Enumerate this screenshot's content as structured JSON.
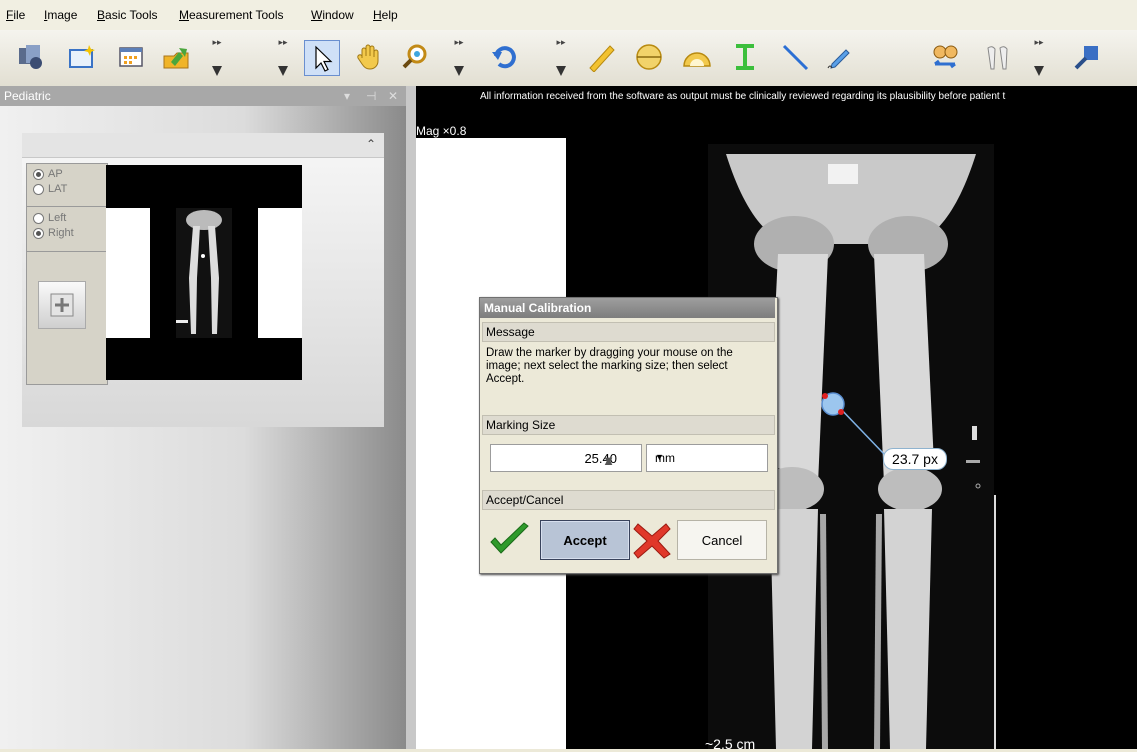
{
  "menu": {
    "items": [
      {
        "accel": "F",
        "rest": "ile"
      },
      {
        "accel": "I",
        "rest": "mage"
      },
      {
        "accel": "B",
        "rest": "asic Tools"
      },
      {
        "accel": "M",
        "rest": "easurement Tools"
      },
      {
        "accel": "W",
        "rest": "indow"
      },
      {
        "accel": "H",
        "rest": "elp"
      }
    ]
  },
  "toolbar": {
    "icons": [
      "open-study-icon",
      "new-image-icon",
      "calendar-icon",
      "export-icon",
      "select-arrow-icon",
      "hand-pan-icon",
      "zoom-icon",
      "undo-icon",
      "ruler-icon",
      "circle-icon",
      "protractor-icon",
      "caliper-icon",
      "line-icon",
      "pen-edit-icon",
      "compare-people-icon",
      "implant-icon",
      "export-dicom-icon"
    ],
    "selected": "select-arrow-icon"
  },
  "left_panel": {
    "title": "Pediatric",
    "title_controls": [
      "▾",
      "⊣",
      "✕"
    ],
    "collapse_glyph": "⌃",
    "view_options": [
      {
        "label": "AP",
        "checked": true
      },
      {
        "label": "LAT",
        "checked": false
      }
    ],
    "side_options": [
      {
        "label": "Left",
        "checked": false
      },
      {
        "label": "Right",
        "checked": true
      }
    ]
  },
  "viewer": {
    "disclaimer": "All information received from the software as output must be clinically reviewed regarding its plausibility before patient t",
    "magnification": "Mag ×0.8",
    "bottom_label": "~2.5 cm",
    "measurement_label": "23.7 px"
  },
  "dialog": {
    "title": "Manual Calibration",
    "message_header": "Message",
    "message": "Draw the marker by dragging your mouse on the image; next select the marking size; then select Accept.",
    "size_header": "Marking Size",
    "size_value": "25.40",
    "unit": "mm",
    "actions_header": "Accept/Cancel",
    "accept_label": "Accept",
    "cancel_label": "Cancel"
  },
  "colors": {
    "accept_bg": "#b8c4d6",
    "check_green": "#2f9a2b",
    "cancel_red": "#e0382a",
    "marker_blue": "#7fb2e6",
    "marker_red": "#e02020"
  }
}
